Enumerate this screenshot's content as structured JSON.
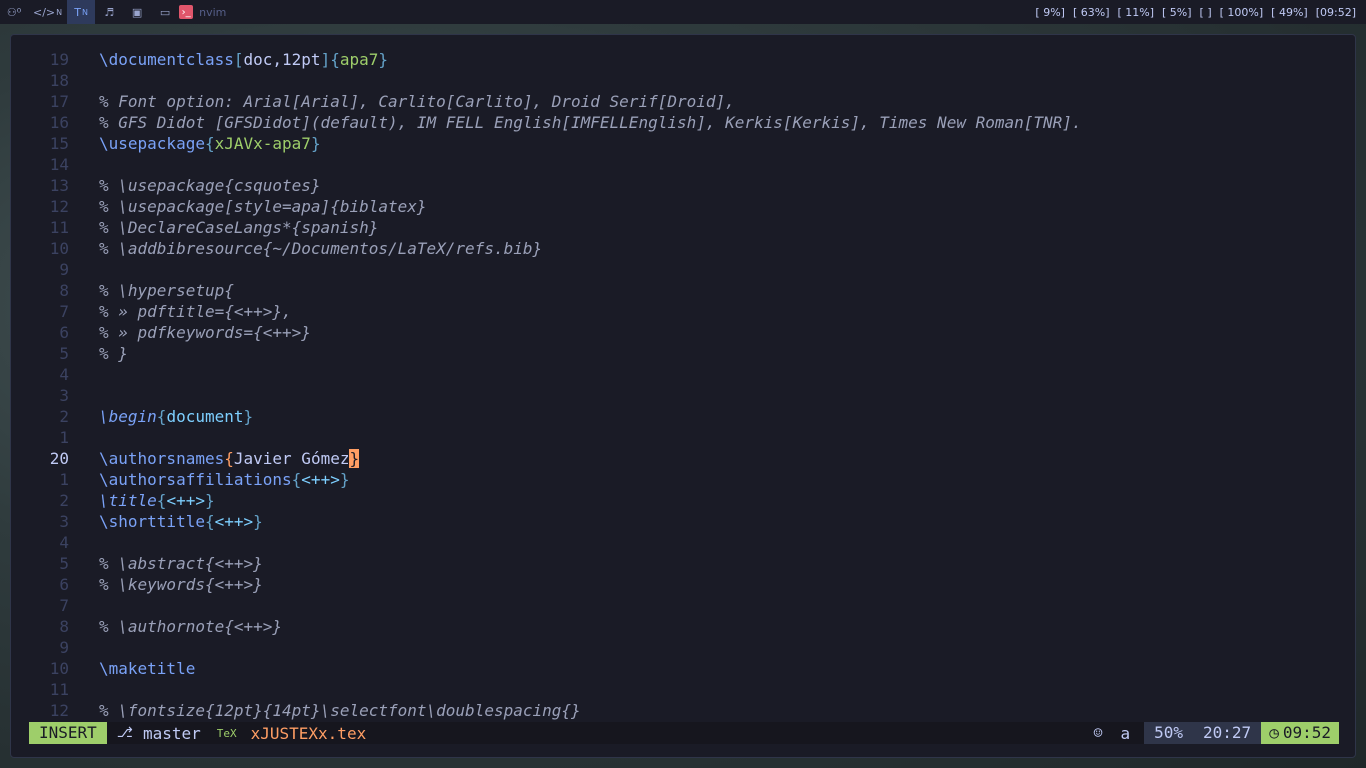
{
  "topbar": {
    "workspaces": [
      {
        "label": "⚇⁰",
        "active": false
      },
      {
        "label": "</>",
        "sup": "N",
        "active": false
      },
      {
        "label": "T",
        "sup": "N",
        "active": true
      },
      {
        "label": "♬",
        "active": false
      },
      {
        "label": "▣",
        "active": false
      },
      {
        "label": "▭",
        "active": false
      }
    ],
    "window_title": "nvim",
    "stats": {
      "cpu": "[ 9%]",
      "memory": "[ 63%]",
      "disk": "[ 11%]",
      "temp": "[ 5%]",
      "mic": "[ ]",
      "volume": "[ 100%]",
      "battery": "[ 49%]",
      "clock": "[09:52]"
    }
  },
  "editor": {
    "lines": [
      {
        "num": "19"
      },
      {
        "num": "18"
      },
      {
        "num": "17"
      },
      {
        "num": "16"
      },
      {
        "num": "15"
      },
      {
        "num": "14"
      },
      {
        "num": "13"
      },
      {
        "num": "12"
      },
      {
        "num": "11"
      },
      {
        "num": "10"
      },
      {
        "num": "9"
      },
      {
        "num": "8"
      },
      {
        "num": "7"
      },
      {
        "num": "6"
      },
      {
        "num": "5"
      },
      {
        "num": "4"
      },
      {
        "num": "3"
      },
      {
        "num": "2"
      },
      {
        "num": "1"
      },
      {
        "num": "20"
      },
      {
        "num": "1"
      },
      {
        "num": "2"
      },
      {
        "num": "3"
      },
      {
        "num": "4"
      },
      {
        "num": "5"
      },
      {
        "num": "6"
      },
      {
        "num": "7"
      },
      {
        "num": "8"
      },
      {
        "num": "9"
      },
      {
        "num": "10"
      },
      {
        "num": "11"
      },
      {
        "num": "12"
      }
    ],
    "text": {
      "l19_cmd": "\\documentclass",
      "l19_opt": "[doc,12pt]",
      "l19_arg": "apa7",
      "l17": "% Font option: Arial[Arial], Carlito[Carlito], Droid Serif[Droid],",
      "l16": "% GFS Didot [GFSDidot](default), IM FELL English[IMFELLEnglish], Kerkis[Kerkis], Times New Roman[TNR].",
      "l15_cmd": "\\usepackage",
      "l15_arg": "xJAVx-apa7",
      "l13": "% \\usepackage{csquotes}",
      "l12": "% \\usepackage[style=apa]{biblatex}",
      "l11": "% \\DeclareCaseLangs*{spanish}",
      "l10": "% \\addbibresource{~/Documentos/LaTeX/refs.bib}",
      "l8": "% \\hypersetup{",
      "l7": "% » pdftitle={<++>},",
      "l6": "% » pdfkeywords={<++>}",
      "l5": "% }",
      "l2_cmd": "\\begin",
      "l2_arg": "document",
      "c_cmd": "\\authorsnames",
      "c_arg": "Javier Gómez",
      "a1_cmd": "\\authorsaffiliations",
      "a2_cmd": "\\title",
      "a3_cmd": "\\shorttitle",
      "placeholder": "<++>",
      "a5": "% \\abstract{<++>}",
      "a6": "% \\keywords{<++>}",
      "a8": "% \\authornote{<++>}",
      "a10_cmd": "\\maketitle",
      "a12": "% \\fontsize{12pt}{14pt}\\selectfont\\doublespacing{}"
    }
  },
  "statusline": {
    "mode": "INSERT",
    "branch": "master",
    "filetype_icon": "TeX",
    "filename": "xJUSTEXx.tex",
    "encoding_flag": "a",
    "percent": "50%",
    "position": "20:27",
    "time": "09:52"
  }
}
